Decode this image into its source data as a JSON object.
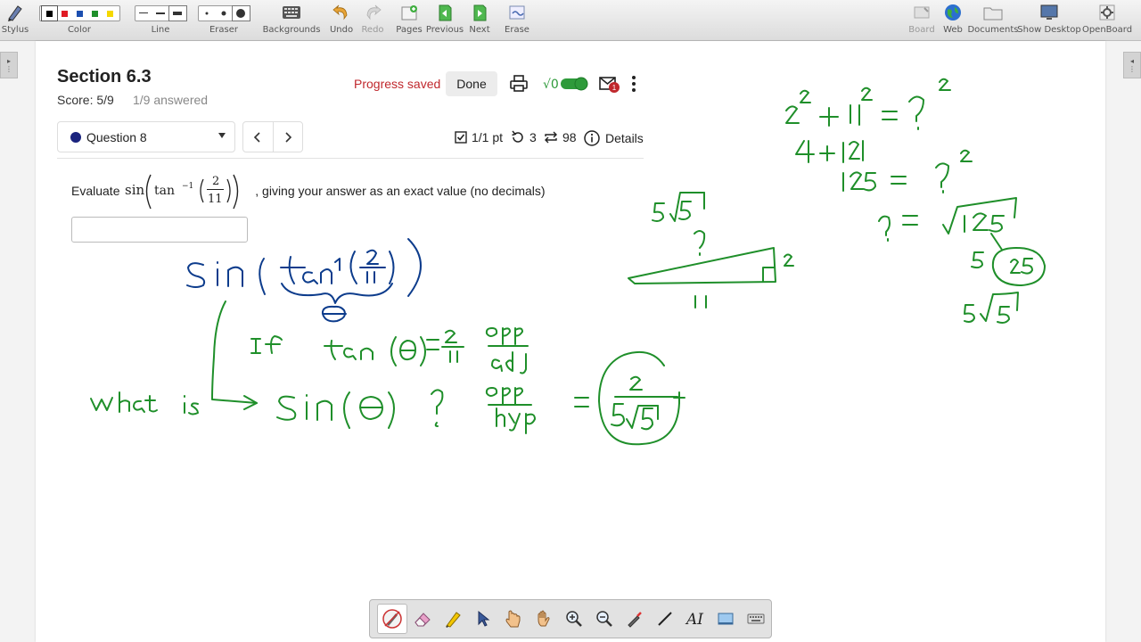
{
  "toolbar": {
    "left": [
      {
        "label": "Stylus",
        "icon": "stylus-icon"
      },
      {
        "label": "Color",
        "icon": "color-swatches"
      },
      {
        "label": "Line",
        "icon": "line-width-selector"
      },
      {
        "label": "Eraser",
        "icon": "eraser-size-selector"
      },
      {
        "label": "Backgrounds",
        "icon": "keyboard-icon"
      },
      {
        "label": "Undo",
        "icon": "undo-icon"
      },
      {
        "label": "Redo",
        "icon": "redo-icon"
      },
      {
        "label": "Pages",
        "icon": "add-page-icon"
      },
      {
        "label": "Previous",
        "icon": "previous-page-icon"
      },
      {
        "label": "Next",
        "icon": "next-page-icon"
      },
      {
        "label": "Erase",
        "icon": "erase-page-icon"
      }
    ],
    "right": [
      {
        "label": "Board",
        "icon": "board-icon"
      },
      {
        "label": "Web",
        "icon": "globe-icon"
      },
      {
        "label": "Documents",
        "icon": "folder-icon"
      },
      {
        "label": "Show Desktop",
        "icon": "monitor-icon"
      },
      {
        "label": "OpenBoard",
        "icon": "gear-icon"
      }
    ],
    "colors": [
      "#000000",
      "#e01b24",
      "#1c4fb0",
      "#1f8f2a",
      "#f5d800"
    ]
  },
  "question": {
    "section_title": "Section 6.3",
    "score": "Score: 5/9",
    "answered": "1/9 answered",
    "progress": "Progress saved",
    "done": "Done",
    "selector": "Question 8",
    "points": "1/1 pt",
    "retries": "3",
    "attempts": "98",
    "details": "Details",
    "notification_count": "1",
    "prompt_prefix": "Evaluate",
    "prompt_suffix": ", giving your answer as an exact value (no decimals)",
    "math": {
      "fn": "sin",
      "inner": "tan",
      "exp": "−1",
      "num": "2",
      "den": "11"
    }
  },
  "accent": {
    "ink_green": "#1f8f2a",
    "ink_blue": "#0d3c8c",
    "progress_red": "#c0282d",
    "toggle_green": "#2e9a3a"
  }
}
